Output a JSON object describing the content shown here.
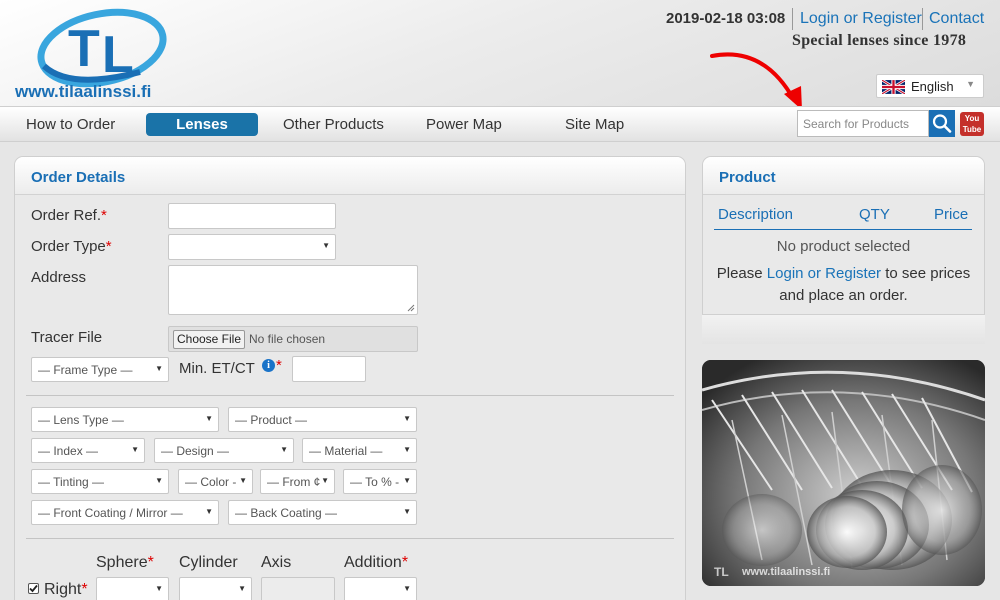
{
  "header": {
    "site_url": "www.tilaalinssi.fi",
    "datetime": "2019-02-18 03:08",
    "login_link": "Login or Register",
    "contact_link": "Contact",
    "slogan": "Special lenses since 1978",
    "language": "English"
  },
  "nav": {
    "items": [
      "How to Order",
      "Lenses",
      "Other Products",
      "Power Map",
      "Site Map"
    ],
    "active": "Lenses",
    "search_placeholder": "Search for Products",
    "youtube_line1": "You",
    "youtube_line2": "Tube"
  },
  "order": {
    "title": "Order Details",
    "order_ref_label": "Order Ref.",
    "order_type_label": "Order Type",
    "address_label": "Address",
    "tracer_label": "Tracer File",
    "choose_file": "Choose File",
    "no_file": "No file chosen",
    "frame_type": "— Frame Type —",
    "min_etct_label": "Min. ET/CT",
    "lens_type": "— Lens Type —",
    "product": "— Product —",
    "index": "— Index —",
    "design": "— Design —",
    "material": "— Material —",
    "tinting": "— Tinting —",
    "color": "— Color -",
    "from": "— From ¢",
    "to_pct": "— To % -",
    "front_coating": "— Front Coating / Mirror —",
    "back_coating": "— Back Coating —",
    "sphere_label": "Sphere",
    "cylinder_label": "Cylinder",
    "axis_label": "Axis",
    "addition_label": "Addition",
    "right_label": "Right",
    "required_mark": "*",
    "info_mark": "i"
  },
  "product_panel": {
    "title": "Product",
    "col_description": "Description",
    "col_qty": "QTY",
    "col_price": "Price",
    "empty_msg": "No product selected",
    "msg_pre": "Please ",
    "msg_link": "Login or Register",
    "msg_post": " to see prices",
    "msg_line2": "and place an order."
  },
  "photo": {
    "watermark": "www.tilaalinssi.fi"
  },
  "colors": {
    "accent": "#1a6fb5",
    "nav_active": "#1a73a8",
    "required": "#dd0000"
  }
}
